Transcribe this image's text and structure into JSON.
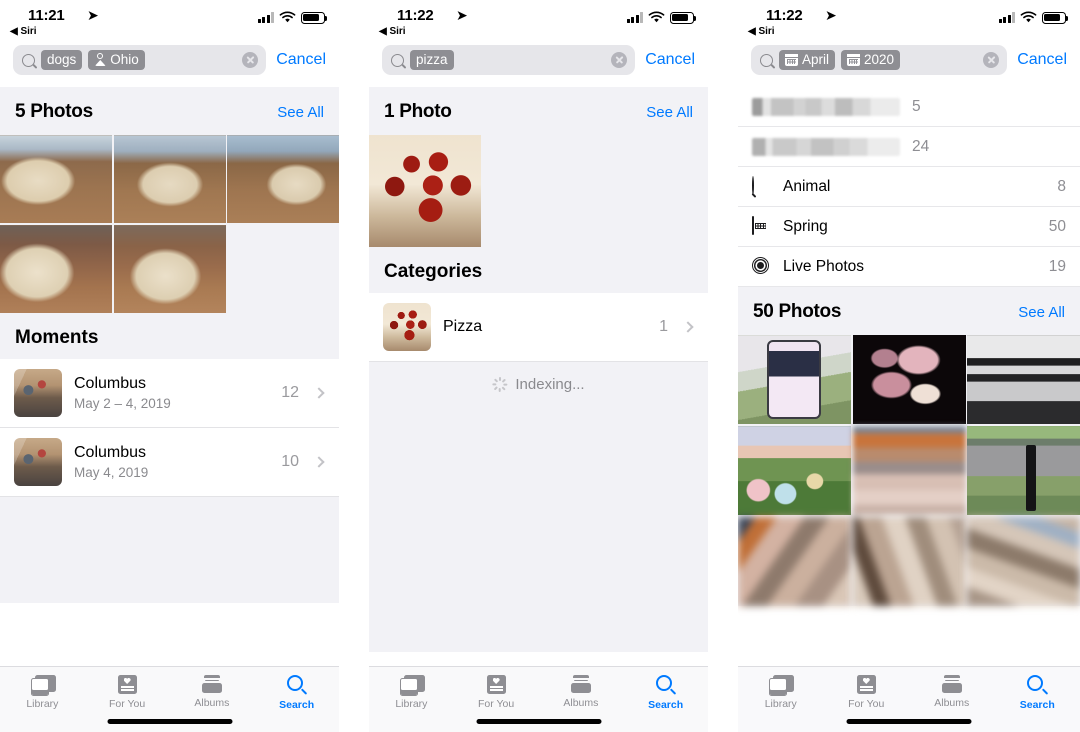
{
  "phones": [
    {
      "id": "phone-dogs",
      "status": {
        "time": "11:21",
        "back_label": "Siri"
      },
      "search": {
        "tokens": [
          {
            "text": "dogs",
            "icon": ""
          },
          {
            "text": "Ohio",
            "icon": "location-pin-icon"
          }
        ],
        "cancel_label": "Cancel"
      },
      "results_header": {
        "title": "5 Photos",
        "see_all": "See All"
      },
      "moments_header": "Moments",
      "moments": [
        {
          "title": "Columbus",
          "subtitle": "May 2 – 4, 2019",
          "count": "12"
        },
        {
          "title": "Columbus",
          "subtitle": "May 4, 2019",
          "count": "10"
        }
      ]
    },
    {
      "id": "phone-pizza",
      "status": {
        "time": "11:22",
        "back_label": "Siri"
      },
      "search": {
        "tokens": [
          {
            "text": "pizza",
            "icon": ""
          }
        ],
        "cancel_label": "Cancel"
      },
      "results_header": {
        "title": "1 Photo",
        "see_all": "See All"
      },
      "categories_header": "Categories",
      "categories": [
        {
          "title": "Pizza",
          "count": "1"
        }
      ],
      "indexing_label": "Indexing..."
    },
    {
      "id": "phone-date",
      "status": {
        "time": "11:22",
        "back_label": "Siri"
      },
      "search": {
        "tokens": [
          {
            "text": "April",
            "icon": "calendar-icon"
          },
          {
            "text": "2020",
            "icon": "calendar-icon"
          }
        ],
        "cancel_label": "Cancel"
      },
      "suggestions": [
        {
          "label": "",
          "count": "5",
          "icon": "redacted",
          "redacted": true
        },
        {
          "label": "",
          "count": "24",
          "icon": "redacted",
          "redacted": true
        },
        {
          "label": "Animal",
          "count": "8",
          "icon": "search-icon"
        },
        {
          "label": "Spring",
          "count": "50",
          "icon": "calendar-icon"
        },
        {
          "label": "Live Photos",
          "count": "19",
          "icon": "live-photos-icon"
        }
      ],
      "results_header": {
        "title": "50 Photos",
        "see_all": "See All"
      }
    }
  ],
  "tabbar": {
    "tabs": [
      {
        "label": "Library",
        "icon": "library-icon",
        "active": false
      },
      {
        "label": "For You",
        "icon": "heart-card-icon",
        "active": false
      },
      {
        "label": "Albums",
        "icon": "albums-icon",
        "active": false
      },
      {
        "label": "Search",
        "icon": "search-icon",
        "active": true
      }
    ]
  },
  "colors": {
    "accent": "#007aff",
    "token_bg": "#8e8e93",
    "field_bg": "#e6e6ea",
    "section_bg": "#f2f2f6",
    "secondary_text": "#8e8e93"
  }
}
